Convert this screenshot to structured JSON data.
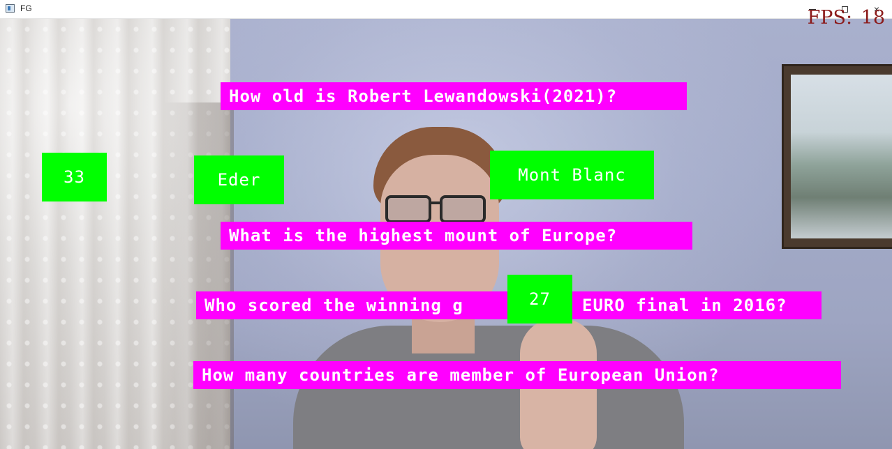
{
  "window": {
    "title": "FG",
    "icon": "app-window-icon",
    "controls": {
      "minimize": "minimize-icon",
      "maximize": "maximize-icon",
      "close": "×"
    }
  },
  "overlay": {
    "fps_label": "FPS: 18",
    "fps_color": "#8b1a1a",
    "question_bg": "#ff00ff",
    "answer_bg": "#00ff00",
    "questions": [
      "How old is Robert Lewandowski(2021)?",
      "What is the highest mount of Europe?",
      "Who scored the winning g",
      "EURO final in 2016?",
      "How many countries are member of European Union?"
    ],
    "answers": [
      "33",
      "Eder",
      "Mont Blanc",
      "27"
    ]
  }
}
